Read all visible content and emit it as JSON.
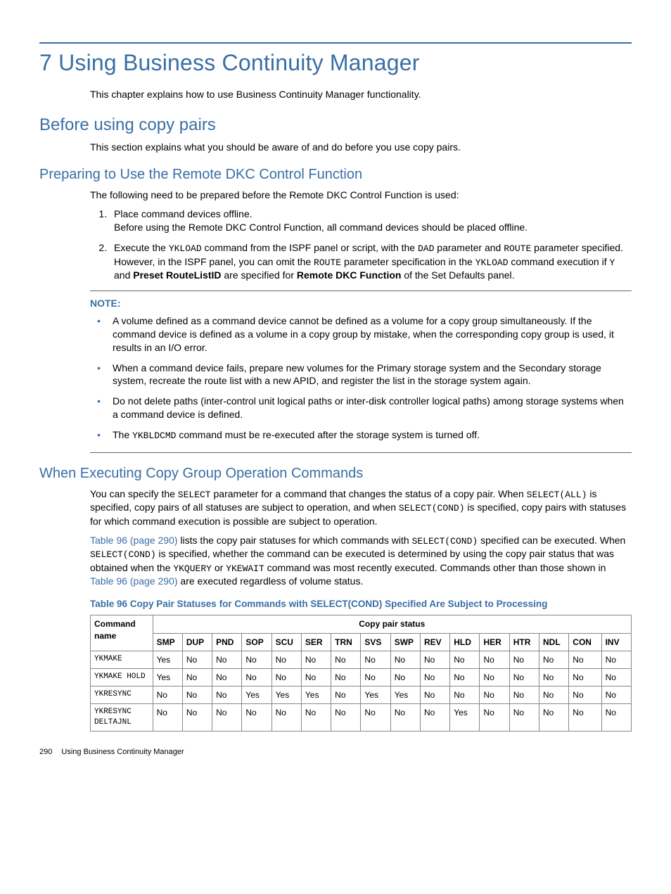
{
  "chapter_title": "7 Using Business Continuity Manager",
  "intro_p": "This chapter explains how to use Business Continuity Manager functionality.",
  "section1_title": "Before using copy pairs",
  "section1_p": "This section explains what you should be aware of and do before you use copy pairs.",
  "sub1_title": "Preparing to Use the Remote DKC Control Function",
  "sub1_p": "The following need to be prepared before the Remote DKC Control Function is used:",
  "step1_a": "Place command devices offline.",
  "step1_b": "Before using the Remote DKC Control Function, all command devices should be placed offline.",
  "step2_a1": "Execute the ",
  "step2_c1": "YKLOAD",
  "step2_a2": " command from the ISPF panel or script, with the ",
  "step2_c2": "DAD",
  "step2_a3": " parameter and ",
  "step2_c3": "ROUTE",
  "step2_a4": " parameter specified. However, in the ISPF panel, you can omit the ",
  "step2_c4": "ROUTE",
  "step2_a5": " parameter specification in the ",
  "step2_c5": "YKLOAD",
  "step2_a6": " command execution if ",
  "step2_c6": "Y",
  "step2_a7": " and ",
  "step2_b1": "Preset RouteListID",
  "step2_a8": " are specified for ",
  "step2_b2": "Remote DKC Function",
  "step2_a9": " of the Set Defaults panel.",
  "note_label": "NOTE:",
  "note_b1": "A volume defined as a command device cannot be defined as a volume for a copy group simultaneously. If the command device is defined as a volume in a copy group by mistake, when the corresponding copy group is used, it results in an I/O error.",
  "note_b2": "When a command device fails, prepare new volumes for the Primary storage system and the Secondary storage system, recreate the route list with a new APID, and register the list in the storage system again.",
  "note_b3": "Do not delete paths (inter-control unit logical paths or inter-disk controller logical paths) among storage systems when a command device is defined.",
  "note_b4_a": "The ",
  "note_b4_c": "YKBLDCMD",
  "note_b4_b": " command must be re-executed after the storage system is turned off.",
  "sub2_title": "When Executing Copy Group Operation Commands",
  "sub2_p1_a": "You can specify the ",
  "sub2_p1_c1": "SELECT",
  "sub2_p1_b": " parameter for a command that changes the status of a copy pair. When ",
  "sub2_p1_c2": "SELECT(ALL)",
  "sub2_p1_d": " is specified, copy pairs of all statuses are subject to operation, and when ",
  "sub2_p1_c3": "SELECT(COND)",
  "sub2_p1_e": " is specified, copy pairs with statuses for which command execution is possible are subject to operation.",
  "sub2_p2_link1": "Table 96 (page 290)",
  "sub2_p2_a": " lists the copy pair statuses for which commands with ",
  "sub2_p2_c1": "SELECT(COND)",
  "sub2_p2_b": " specified can be executed. When ",
  "sub2_p2_c2": "SELECT(COND)",
  "sub2_p2_d": " is specified, whether the command can be executed is determined by using the copy pair status that was obtained when the ",
  "sub2_p2_c3": "YKQUERY",
  "sub2_p2_e": " or ",
  "sub2_p2_c4": "YKEWAIT",
  "sub2_p2_f": " command was most recently executed. Commands other than those shown in ",
  "sub2_p2_link2": "Table 96 (page 290)",
  "sub2_p2_g": " are executed regardless of volume status.",
  "table_caption": "Table 96 Copy Pair Statuses for Commands with SELECT(COND) Specified Are Subject to Processing",
  "table": {
    "colhead_cmd": "Command name",
    "colhead_span": "Copy pair status",
    "columns": [
      "SMP",
      "DUP",
      "PND",
      "SOP",
      "SCU",
      "SER",
      "TRN",
      "SVS",
      "SWP",
      "REV",
      "HLD",
      "HER",
      "HTR",
      "NDL",
      "CON",
      "INV"
    ],
    "rows": [
      {
        "cmd": "YKMAKE",
        "cells": [
          "Yes",
          "No",
          "No",
          "No",
          "No",
          "No",
          "No",
          "No",
          "No",
          "No",
          "No",
          "No",
          "No",
          "No",
          "No",
          "No"
        ]
      },
      {
        "cmd": "YKMAKE HOLD",
        "cells": [
          "Yes",
          "No",
          "No",
          "No",
          "No",
          "No",
          "No",
          "No",
          "No",
          "No",
          "No",
          "No",
          "No",
          "No",
          "No",
          "No"
        ]
      },
      {
        "cmd": "YKRESYNC",
        "cells": [
          "No",
          "No",
          "No",
          "Yes",
          "Yes",
          "Yes",
          "No",
          "Yes",
          "Yes",
          "No",
          "No",
          "No",
          "No",
          "No",
          "No",
          "No"
        ]
      },
      {
        "cmd": "YKRESYNC DELTAJNL",
        "cells": [
          "No",
          "No",
          "No",
          "No",
          "No",
          "No",
          "No",
          "No",
          "No",
          "No",
          "Yes",
          "No",
          "No",
          "No",
          "No",
          "No"
        ]
      }
    ]
  },
  "footer_page": "290",
  "footer_text": "Using Business Continuity Manager"
}
